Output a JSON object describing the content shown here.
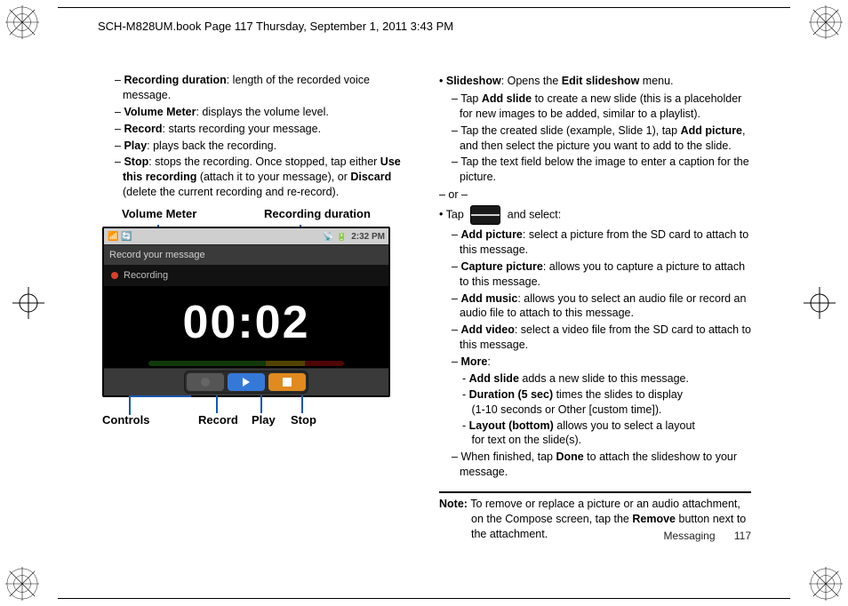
{
  "header": "SCH-M828UM.book  Page 117  Thursday, September 1, 2011  3:43 PM",
  "left": {
    "items": [
      {
        "term": "Recording duration",
        "desc": ": length of the recorded voice message."
      },
      {
        "term": "Volume Meter",
        "desc": ": displays the volume level."
      },
      {
        "term": "Record",
        "desc": ": starts recording your message."
      },
      {
        "term": "Play",
        "desc": ": plays back the recording."
      }
    ],
    "stop_term": "Stop",
    "stop_before": ": stops the recording. Once stopped, tap either ",
    "stop_use": "Use this recording",
    "stop_mid": " (attach it to your message), or ",
    "stop_discard": "Discard",
    "stop_after": " (delete the current recording and re-record)."
  },
  "fig": {
    "vm": "Volume Meter",
    "rd": "Recording duration",
    "titlebar": "Record your message",
    "rec": "Recording",
    "timer": "00:02",
    "clock": "2:32 PM",
    "controls": "Controls",
    "record": "Record",
    "play": "Play",
    "stop": "Stop",
    "status_left": "📶  🔄",
    "status_right": "📡  🔋"
  },
  "right": {
    "slideshow_term": "Slideshow",
    "slideshow_mid": ": Opens the ",
    "slideshow_menu": "Edit slideshow",
    "slideshow_end": " menu.",
    "s_sub1_pre": "Tap ",
    "s_sub1_b": "Add slide",
    "s_sub1_post": " to create a new slide (this is a placeholder for new images to be added, similar to a playlist).",
    "s_sub2_pre": "Tap the created slide (example, Slide 1), tap ",
    "s_sub2_b": "Add picture",
    "s_sub2_post": ", and then select the picture you want to add to the slide.",
    "s_sub3": "Tap the text field below the image to enter a caption for the picture.",
    "or": "– or –",
    "tap_pre": "Tap ",
    "tap_post": " and select:",
    "opts": [
      {
        "b": "Add picture",
        "t": ": select a picture from the SD card to attach to this message."
      },
      {
        "b": "Capture picture",
        "t": ": allows you to capture a picture to attach to this message."
      },
      {
        "b": "Add music",
        "t": ": allows you to select an audio file or record an audio file to attach to this message."
      },
      {
        "b": "Add video",
        "t": ": select a video file from the SD card to attach to this message."
      }
    ],
    "more": "More",
    "more_items": [
      {
        "b": "Add slide",
        "t": " adds a new slide to this message."
      },
      {
        "b": "Duration (5 sec)",
        "t": " times the slides to display",
        "t2": "(1-10 seconds or Other [custom time])."
      },
      {
        "b": "Layout (bottom)",
        "t": " allows you to select a layout",
        "t2": "for text on the slide(s)."
      }
    ],
    "done_pre": "When finished, tap ",
    "done_b": "Done",
    "done_post": " to attach the slideshow to your message.",
    "note_b": "Note:",
    "note_pre": " To remove or replace a picture or an audio attachment, on the Compose screen, tap the ",
    "note_rb": "Remove",
    "note_post": " button next to the attachment.",
    "footer_section": "Messaging",
    "footer_page": "117"
  }
}
